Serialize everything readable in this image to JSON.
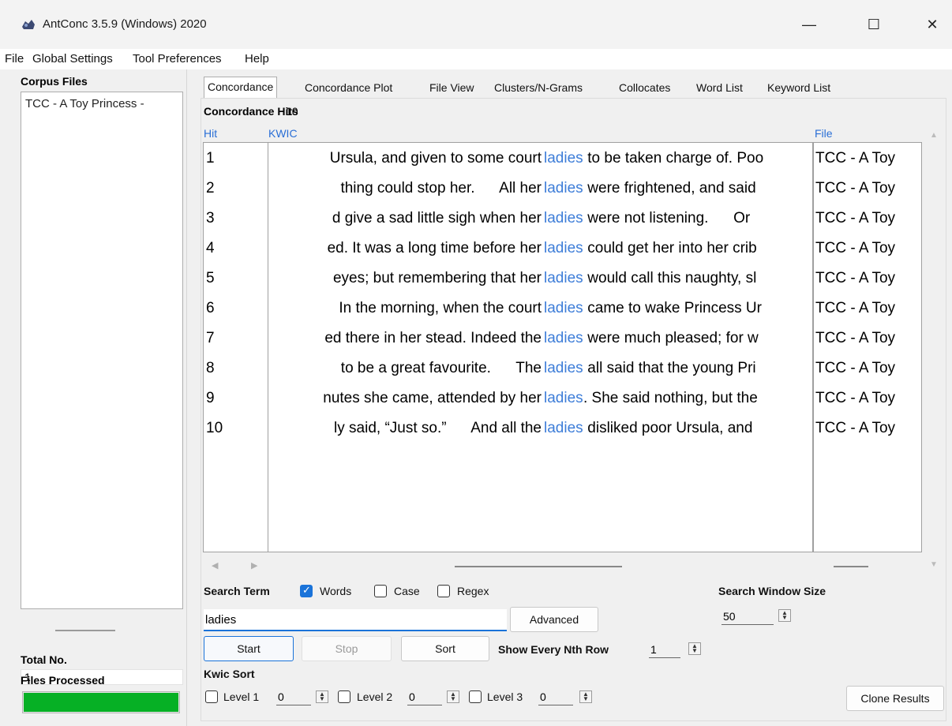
{
  "window": {
    "title": "AntConc 3.5.9 (Windows) 2020",
    "minimize": "—",
    "maximize": "☐",
    "close": "✕"
  },
  "menu": [
    "File",
    "Global Settings",
    "Tool Preferences",
    "Help"
  ],
  "left_pane": {
    "corpus_files_label": "Corpus Files",
    "files": [
      "TCC - A Toy Princess -"
    ],
    "total_no_label": "Total No.",
    "total_no_value": "1",
    "files_processed_label": "Files Processed",
    "progress": 1.0
  },
  "tabs": [
    "Concordance",
    "Concordance Plot",
    "File View",
    "Clusters/N-Grams",
    "Collocates",
    "Word List",
    "Keyword List"
  ],
  "active_tab": "Concordance",
  "concordance": {
    "hits_label": "Concordance Hits",
    "hits_value": "10",
    "col_hit": "Hit",
    "col_kwic": "KWIC",
    "col_file": "File",
    "rows": [
      {
        "num": "1",
        "left": "Ursula, and given to some court",
        "hit": "ladies",
        "right": " to be taken charge of. Poo",
        "file": "TCC - A Toy"
      },
      {
        "num": "2",
        "left": "thing could stop her.      All her",
        "hit": "ladies",
        "right": " were frightened, and said",
        "file": "TCC - A Toy"
      },
      {
        "num": "3",
        "left": "d give a sad little sigh when her",
        "hit": "ladies",
        "right": " were not listening.      Or",
        "file": "TCC - A Toy"
      },
      {
        "num": "4",
        "left": "ed. It was a long time before her",
        "hit": "ladies",
        "right": " could get her into her crib",
        "file": "TCC - A Toy"
      },
      {
        "num": "5",
        "left": "eyes; but remembering that her",
        "hit": "ladies",
        "right": " would call this naughty, sl",
        "file": "TCC - A Toy"
      },
      {
        "num": "6",
        "left": " In the morning, when the court",
        "hit": "ladies",
        "right": " came to wake Princess Ur",
        "file": "TCC - A Toy"
      },
      {
        "num": "7",
        "left": "ed there in her stead. Indeed the",
        "hit": "ladies",
        "right": " were much pleased; for w",
        "file": "TCC - A Toy"
      },
      {
        "num": "8",
        "left": " to be a great favourite.      The",
        "hit": "ladies",
        "right": " all said that the young Pri",
        "file": "TCC - A Toy"
      },
      {
        "num": "9",
        "left": "nutes she came, attended by her",
        "hit": "ladies",
        "right": ". She said nothing, but the",
        "file": "TCC - A Toy"
      },
      {
        "num": "10",
        "left": "ly said, “Just so.”      And all the",
        "hit": "ladies",
        "right": " disliked poor Ursula, and",
        "file": "TCC - A Toy"
      }
    ]
  },
  "search": {
    "search_term_label": "Search Term",
    "words_label": "Words",
    "words_checked": true,
    "case_label": "Case",
    "case_checked": false,
    "regex_label": "Regex",
    "regex_checked": false,
    "term_value": "ladies",
    "advanced_label": "Advanced",
    "window_size_label": "Search Window Size",
    "window_size_value": "50",
    "start_label": "Start",
    "stop_label": "Stop",
    "sort_label": "Sort",
    "nth_row_label": "Show Every Nth Row",
    "nth_row_value": "1",
    "kwic_sort_label": "Kwic Sort",
    "level1_label": "Level 1",
    "level1_value": "0",
    "level2_label": "Level 2",
    "level2_value": "0",
    "level3_label": "Level 3",
    "level3_value": "0",
    "clone_label": "Clone Results"
  },
  "colors": {
    "hit_word": "#3d7dd8",
    "progress": "#06b025",
    "accent": "#1a73d9"
  }
}
